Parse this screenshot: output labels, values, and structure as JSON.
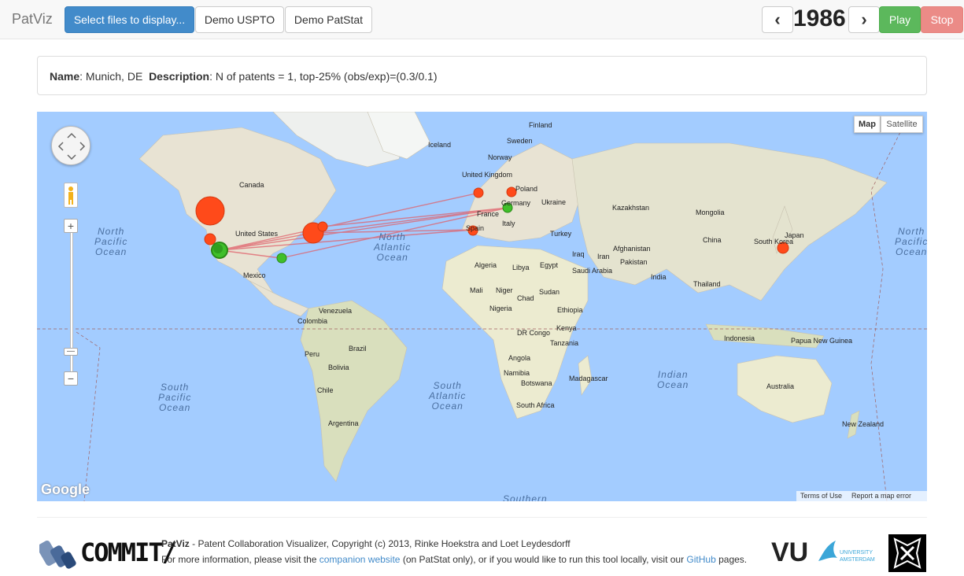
{
  "navbar": {
    "brand": "PatViz",
    "select_files": "Select files to display...",
    "demo_uspto": "Demo USPTO",
    "demo_patstat": "Demo PatStat",
    "prev": "‹",
    "year": "1986",
    "next": "›",
    "play": "Play",
    "stop": "Stop"
  },
  "info": {
    "name_label": "Name",
    "name_value": ": Munich, DE",
    "desc_label": "Description",
    "desc_value": ": N of patents = 1, top-25% (obs/exp)=(0.3/0.1)"
  },
  "map": {
    "map_btn": "Map",
    "satellite_btn": "Satellite",
    "zoom_in": "+",
    "zoom_out": "−",
    "google": "Google",
    "terms": "Terms of Use",
    "report": "Report a map error",
    "countries": [
      "Finland",
      "Iceland",
      "Sweden",
      "Norway",
      "United Kingdom",
      "Poland",
      "Germany",
      "France",
      "Ukraine",
      "Kazakhstan",
      "Mongolia",
      "Spain",
      "Italy",
      "Turkey",
      "China",
      "South Korea",
      "Japan",
      "Canada",
      "United States",
      "Mexico",
      "Iraq",
      "Iran",
      "Afghanistan",
      "Pakistan",
      "India",
      "Thailand",
      "Algeria",
      "Libya",
      "Egypt",
      "Saudi Arabia",
      "Mali",
      "Niger",
      "Chad",
      "Sudan",
      "Nigeria",
      "Ethiopia",
      "Kenya",
      "DR Congo",
      "Tanzania",
      "Venezuela",
      "Colombia",
      "Peru",
      "Brazil",
      "Bolivia",
      "Chile",
      "Argentina",
      "Angola",
      "Namibia",
      "Botswana",
      "Madagascar",
      "South Africa",
      "Indonesia",
      "Papua New Guinea",
      "Australia",
      "New Zealand"
    ],
    "oceans": [
      "North Pacific Ocean",
      "North Atlantic Ocean",
      "South Pacific Ocean",
      "South Atlantic Ocean",
      "Indian Ocean",
      "Southern"
    ]
  },
  "footer": {
    "commit": "COMMIT/",
    "app": "PatViz",
    "line1": " - Patent Collaboration Visualizer, Copyright (c) 2013, Rinke Hoekstra and Loet Leydesdorff",
    "line2a": "For more information, please visit the ",
    "companion": "companion website",
    "line2b": " (on PatStat only), or if you would like to run this tool locally, visit our ",
    "github": "GitHub",
    "line2c": " pages.",
    "vu": "VU",
    "vu_sub": "UNIVERSITY\nAMSTERDAM"
  },
  "colors": {
    "node_red": "#ff4a1a",
    "node_green": "#3fbf2a",
    "link": "#e0606a"
  }
}
